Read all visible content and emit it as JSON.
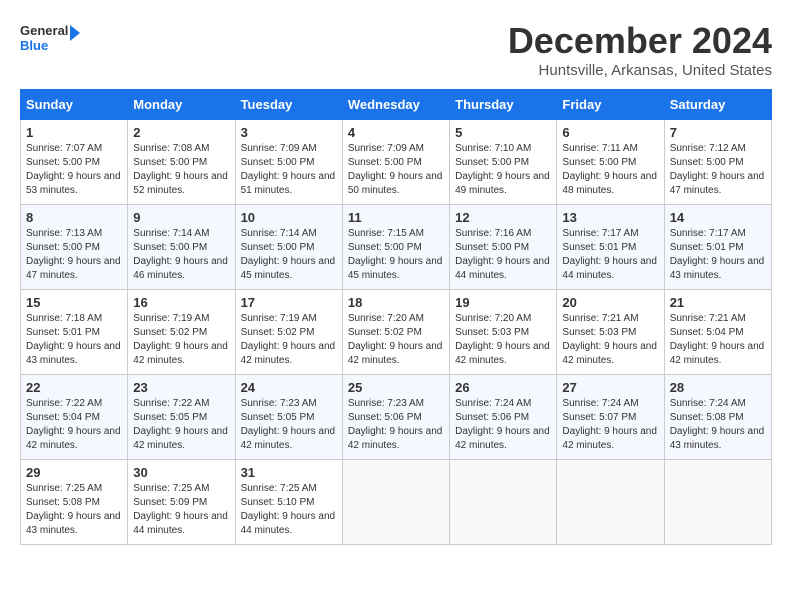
{
  "logo": {
    "line1": "General",
    "line2": "Blue"
  },
  "title": "December 2024",
  "location": "Huntsville, Arkansas, United States",
  "days_of_week": [
    "Sunday",
    "Monday",
    "Tuesday",
    "Wednesday",
    "Thursday",
    "Friday",
    "Saturday"
  ],
  "weeks": [
    [
      {
        "day": "1",
        "sunrise": "7:07 AM",
        "sunset": "5:00 PM",
        "daylight": "9 hours and 53 minutes."
      },
      {
        "day": "2",
        "sunrise": "7:08 AM",
        "sunset": "5:00 PM",
        "daylight": "9 hours and 52 minutes."
      },
      {
        "day": "3",
        "sunrise": "7:09 AM",
        "sunset": "5:00 PM",
        "daylight": "9 hours and 51 minutes."
      },
      {
        "day": "4",
        "sunrise": "7:09 AM",
        "sunset": "5:00 PM",
        "daylight": "9 hours and 50 minutes."
      },
      {
        "day": "5",
        "sunrise": "7:10 AM",
        "sunset": "5:00 PM",
        "daylight": "9 hours and 49 minutes."
      },
      {
        "day": "6",
        "sunrise": "7:11 AM",
        "sunset": "5:00 PM",
        "daylight": "9 hours and 48 minutes."
      },
      {
        "day": "7",
        "sunrise": "7:12 AM",
        "sunset": "5:00 PM",
        "daylight": "9 hours and 47 minutes."
      }
    ],
    [
      {
        "day": "8",
        "sunrise": "7:13 AM",
        "sunset": "5:00 PM",
        "daylight": "9 hours and 47 minutes."
      },
      {
        "day": "9",
        "sunrise": "7:14 AM",
        "sunset": "5:00 PM",
        "daylight": "9 hours and 46 minutes."
      },
      {
        "day": "10",
        "sunrise": "7:14 AM",
        "sunset": "5:00 PM",
        "daylight": "9 hours and 45 minutes."
      },
      {
        "day": "11",
        "sunrise": "7:15 AM",
        "sunset": "5:00 PM",
        "daylight": "9 hours and 45 minutes."
      },
      {
        "day": "12",
        "sunrise": "7:16 AM",
        "sunset": "5:00 PM",
        "daylight": "9 hours and 44 minutes."
      },
      {
        "day": "13",
        "sunrise": "7:17 AM",
        "sunset": "5:01 PM",
        "daylight": "9 hours and 44 minutes."
      },
      {
        "day": "14",
        "sunrise": "7:17 AM",
        "sunset": "5:01 PM",
        "daylight": "9 hours and 43 minutes."
      }
    ],
    [
      {
        "day": "15",
        "sunrise": "7:18 AM",
        "sunset": "5:01 PM",
        "daylight": "9 hours and 43 minutes."
      },
      {
        "day": "16",
        "sunrise": "7:19 AM",
        "sunset": "5:02 PM",
        "daylight": "9 hours and 42 minutes."
      },
      {
        "day": "17",
        "sunrise": "7:19 AM",
        "sunset": "5:02 PM",
        "daylight": "9 hours and 42 minutes."
      },
      {
        "day": "18",
        "sunrise": "7:20 AM",
        "sunset": "5:02 PM",
        "daylight": "9 hours and 42 minutes."
      },
      {
        "day": "19",
        "sunrise": "7:20 AM",
        "sunset": "5:03 PM",
        "daylight": "9 hours and 42 minutes."
      },
      {
        "day": "20",
        "sunrise": "7:21 AM",
        "sunset": "5:03 PM",
        "daylight": "9 hours and 42 minutes."
      },
      {
        "day": "21",
        "sunrise": "7:21 AM",
        "sunset": "5:04 PM",
        "daylight": "9 hours and 42 minutes."
      }
    ],
    [
      {
        "day": "22",
        "sunrise": "7:22 AM",
        "sunset": "5:04 PM",
        "daylight": "9 hours and 42 minutes."
      },
      {
        "day": "23",
        "sunrise": "7:22 AM",
        "sunset": "5:05 PM",
        "daylight": "9 hours and 42 minutes."
      },
      {
        "day": "24",
        "sunrise": "7:23 AM",
        "sunset": "5:05 PM",
        "daylight": "9 hours and 42 minutes."
      },
      {
        "day": "25",
        "sunrise": "7:23 AM",
        "sunset": "5:06 PM",
        "daylight": "9 hours and 42 minutes."
      },
      {
        "day": "26",
        "sunrise": "7:24 AM",
        "sunset": "5:06 PM",
        "daylight": "9 hours and 42 minutes."
      },
      {
        "day": "27",
        "sunrise": "7:24 AM",
        "sunset": "5:07 PM",
        "daylight": "9 hours and 42 minutes."
      },
      {
        "day": "28",
        "sunrise": "7:24 AM",
        "sunset": "5:08 PM",
        "daylight": "9 hours and 43 minutes."
      }
    ],
    [
      {
        "day": "29",
        "sunrise": "7:25 AM",
        "sunset": "5:08 PM",
        "daylight": "9 hours and 43 minutes."
      },
      {
        "day": "30",
        "sunrise": "7:25 AM",
        "sunset": "5:09 PM",
        "daylight": "9 hours and 44 minutes."
      },
      {
        "day": "31",
        "sunrise": "7:25 AM",
        "sunset": "5:10 PM",
        "daylight": "9 hours and 44 minutes."
      },
      null,
      null,
      null,
      null
    ]
  ],
  "labels": {
    "sunrise": "Sunrise:",
    "sunset": "Sunset:",
    "daylight": "Daylight:"
  }
}
